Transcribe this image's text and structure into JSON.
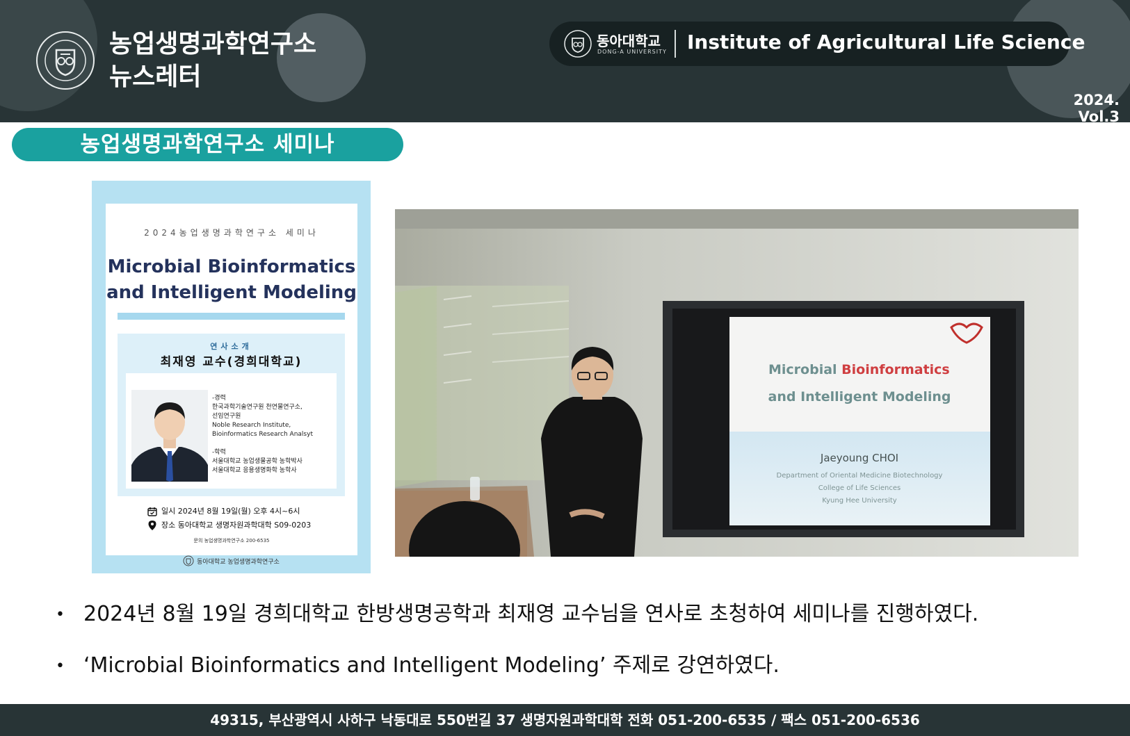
{
  "header": {
    "title_line1": "농업생명과학연구소",
    "title_line2": "뉴스레터",
    "logo_name_ko": "동아대학교",
    "logo_name_en": "DONG-A UNIVERSITY",
    "institute_en": "Institute of Agricultural Life Science",
    "volume": "2024. Vol.3"
  },
  "section": {
    "title": "농업생명과학연구소 세미나"
  },
  "poster": {
    "kicker": "2024농업생명과학연구소 세미나",
    "title_line1": "Microbial Bioinformatics",
    "title_line2": "and Intelligent Modeling",
    "speaker_kicker": "연사소개",
    "speaker_name": "최재영 교수(경희대학교)",
    "bio": "-경력\n한국과학기술연구원 천연물연구소,\n선임연구원\nNoble Research Institute,\nBioinformatics Research Analsyt\n\n-학력\n서울대학교 농업생물공학 농학박사\n서울대학교 응용생명화학 농학사",
    "date": "일시  2024년 8월 19일(월) 오후 4시~6시",
    "place": "장소  동아대학교 생명자원과학대학 S09-0203",
    "contact": "문의  농업생명과학연구소 200-6535",
    "footer": "동아대학교 농업생명과학연구소"
  },
  "photo": {
    "slide_title_part1": "Microbial ",
    "slide_title_part2": "Bioinformatics",
    "slide_title_line2": "and Intelligent Modeling",
    "slide_speaker": "Jaeyoung CHOI",
    "slide_dept": "Department of Oriental Medicine Biotechnology",
    "slide_college": "College of Life Sciences",
    "slide_univ": "Kyung Hee University"
  },
  "bullets": [
    "2024년 8월 19일 경희대학교 한방생명공학과 최재영 교수님을 연사로 초청하여 세미나를 진행하였다.",
    "‘Microbial Bioinformatics and Intelligent Modeling’ 주제로 강연하였다."
  ],
  "bullet_marker": "•",
  "footer": {
    "address": "49315, 부산광역시 사하구 낙동대로 550번길 37 생명자원과학대학  전화 051-200-6535 / 팩스 051-200-6536"
  },
  "colors": {
    "header_bg": "#283436",
    "banner_teal": "#1aa19f",
    "poster_blue": "#b6e1f2",
    "poster_navy": "#24325c"
  }
}
